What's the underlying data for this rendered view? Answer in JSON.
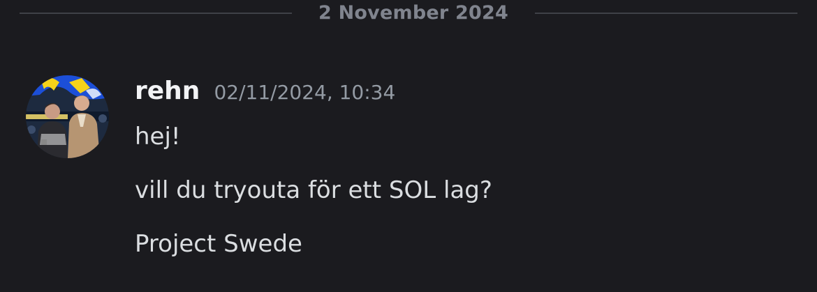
{
  "divider": {
    "date": "2 November 2024"
  },
  "message": {
    "author": "rehn",
    "timestamp": "02/11/2024, 10:34",
    "avatar": "user-avatar-photo",
    "lines": [
      "hej!",
      "vill du tryouta för ett SOL lag?",
      "Project Swede"
    ]
  },
  "colors": {
    "background": "#1b1b1f",
    "divider": "#3f4147",
    "muted_text": "#80848e",
    "username": "#f2f3f5",
    "message_text": "#dbdee1"
  }
}
